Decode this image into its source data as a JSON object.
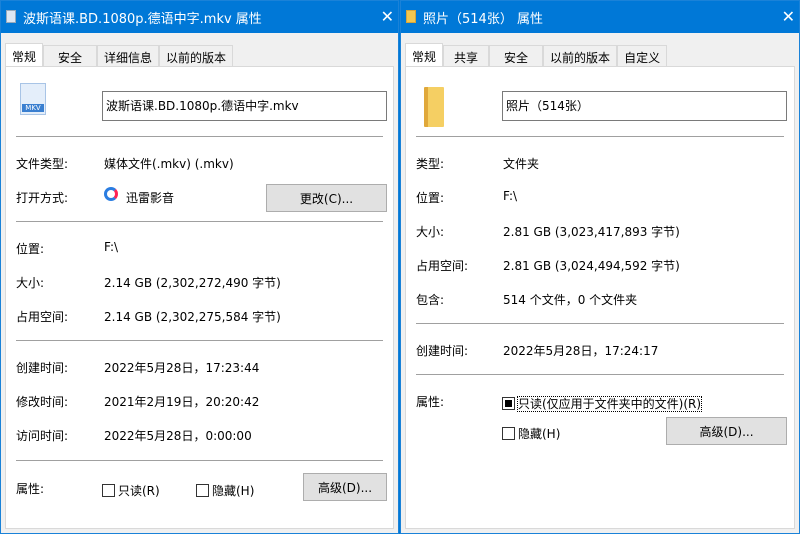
{
  "left": {
    "title": "波斯语课.BD.1080p.德语中字.mkv 属性",
    "tabs": [
      "常规",
      "安全",
      "详细信息",
      "以前的版本"
    ],
    "filename": "波斯语课.BD.1080p.德语中字.mkv",
    "file_icon_label": "MKV",
    "rows": {
      "type_label": "文件类型:",
      "type_value": "媒体文件(.mkv) (.mkv)",
      "open_label": "打开方式:",
      "open_value": "迅雷影音",
      "change_button": "更改(C)...",
      "location_label": "位置:",
      "location_value": "F:\\",
      "size_label": "大小:",
      "size_value": "2.14 GB (2,302,272,490 字节)",
      "disk_label": "占用空间:",
      "disk_value": "2.14 GB (2,302,275,584 字节)",
      "created_label": "创建时间:",
      "created_value": "2022年5月28日，17:23:44",
      "modified_label": "修改时间:",
      "modified_value": "2021年2月19日，20:20:42",
      "accessed_label": "访问时间:",
      "accessed_value": "2022年5月28日，0:00:00",
      "attr_label": "属性:",
      "readonly": "只读(R)",
      "hidden": "隐藏(H)",
      "advanced_button": "高级(D)..."
    }
  },
  "right": {
    "title": "照片（514张） 属性",
    "tabs": [
      "常规",
      "共享",
      "安全",
      "以前的版本",
      "自定义"
    ],
    "foldername": "照片（514张）",
    "rows": {
      "type_label": "类型:",
      "type_value": "文件夹",
      "location_label": "位置:",
      "location_value": "F:\\",
      "size_label": "大小:",
      "size_value": "2.81 GB (3,023,417,893 字节)",
      "disk_label": "占用空间:",
      "disk_value": "2.81 GB (3,024,494,592 字节)",
      "contains_label": "包含:",
      "contains_value": "514 个文件，0 个文件夹",
      "created_label": "创建时间:",
      "created_value": "2022年5月28日，17:24:17",
      "attr_label": "属性:",
      "readonly": "只读(仅应用于文件夹中的文件)(R)",
      "hidden": "隐藏(H)",
      "advanced_button": "高级(D)..."
    }
  }
}
